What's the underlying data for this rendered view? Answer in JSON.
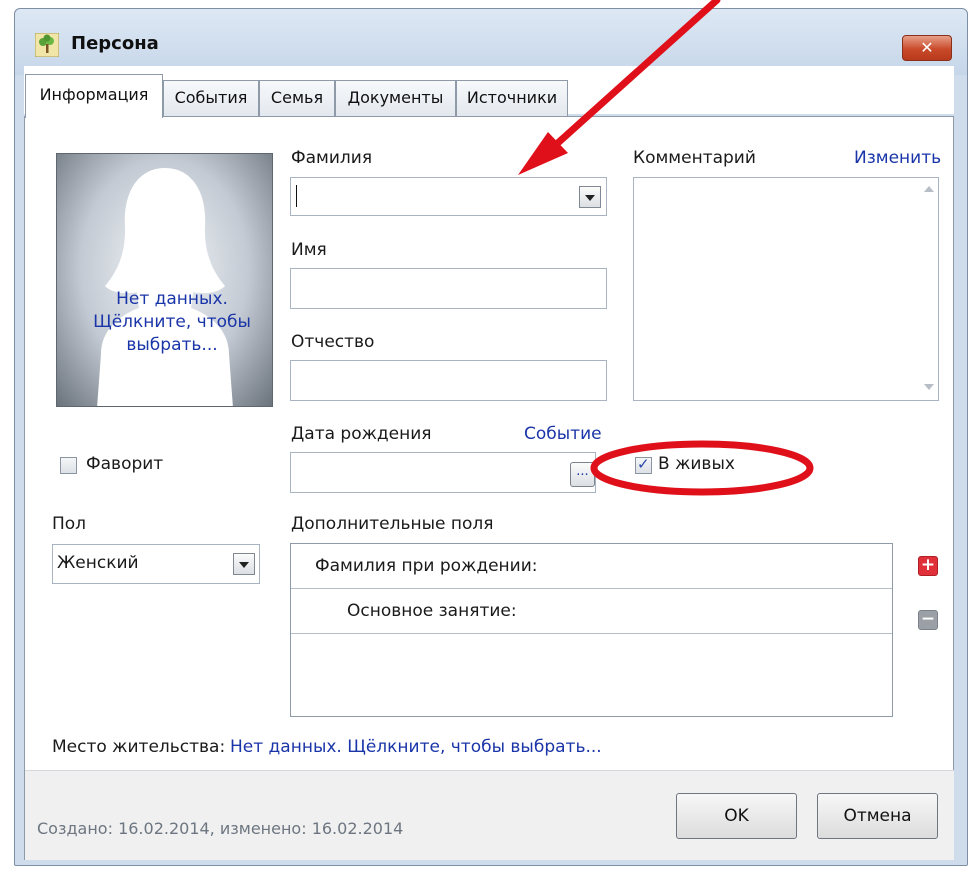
{
  "window": {
    "title": "Персона",
    "close_glyph": "✕"
  },
  "tabs": [
    {
      "label": "Информация",
      "active": true
    },
    {
      "label": "События",
      "active": false
    },
    {
      "label": "Семья",
      "active": false
    },
    {
      "label": "Документы",
      "active": false
    },
    {
      "label": "Источники",
      "active": false
    }
  ],
  "photo": {
    "text": "Нет данных. Щёлкните, чтобы выбрать..."
  },
  "form": {
    "surname_label": "Фамилия",
    "surname_value": "",
    "name_label": "Имя",
    "name_value": "",
    "patronymic_label": "Отчество",
    "patronymic_value": "",
    "birthdate_label": "Дата рождения",
    "birthdate_value": "",
    "event_link": "Событие",
    "browse_label": "...",
    "comment_label": "Комментарий",
    "comment_edit_link": "Изменить",
    "comment_value": ""
  },
  "favorite": {
    "label": "Фаворит",
    "checked": false
  },
  "alive": {
    "label": "В живых",
    "checked": true
  },
  "gender": {
    "label": "Пол",
    "value": "Женский"
  },
  "extra_fields": {
    "label": "Дополнительные поля",
    "rows": [
      {
        "label": "Фамилия при рождении:"
      },
      {
        "label": "Основное занятие:"
      }
    ],
    "add_glyph": "+",
    "remove_glyph": "−"
  },
  "residence": {
    "label": "Место жительства:",
    "link": "Нет данных. Щёлкните, чтобы выбрать..."
  },
  "footer": {
    "status": "Создано: 16.02.2014, изменено: 16.02.2014",
    "ok_label": "OK",
    "cancel_label": "Отмена"
  },
  "colors": {
    "link_blue": "#1a35a8",
    "annotation_red": "#e0101a",
    "close_red": "#c84a2a"
  },
  "icons": [
    "tree-icon",
    "close-icon",
    "chevron-down-icon",
    "checkmark-icon",
    "plus-icon",
    "minus-icon"
  ]
}
